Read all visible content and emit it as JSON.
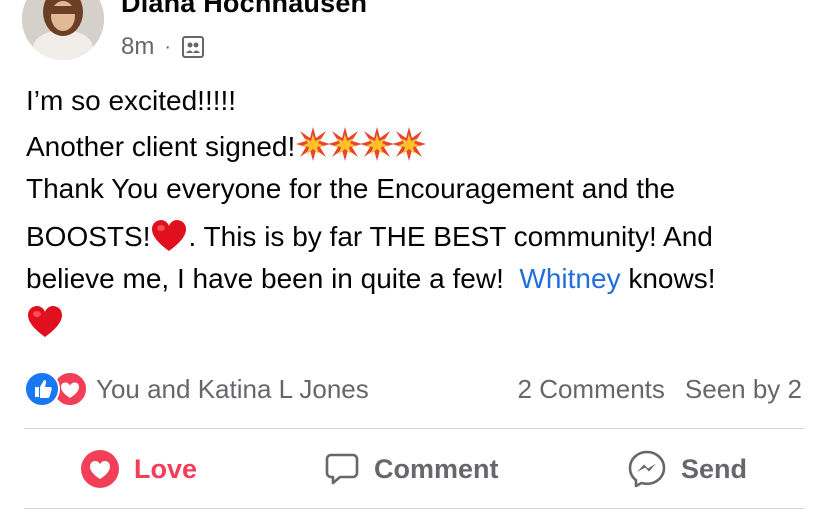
{
  "post": {
    "author": "Diana Hochhausen",
    "time": "8m",
    "separator": "·",
    "audience_icon": "group-icon",
    "more_icon": "more-horizontal-icon"
  },
  "content": {
    "line1": "I’m so excited!!!!!",
    "line2": "Another client signed!",
    "line3": "Thank You everyone for the Encouragement and the",
    "line4a": "BOOSTS!",
    "line4b": ". This is by far THE BEST community!  And",
    "line5a": "believe me, I have been in quite a few!  ",
    "mention": "Whitney",
    "line5b": " knows!",
    "emojis": [
      "collision-emoji",
      "collision-emoji",
      "collision-emoji",
      "collision-emoji",
      "red-heart-emoji",
      "red-heart-emoji"
    ]
  },
  "reactions": {
    "names": "You and Katina L Jones",
    "comments": "2 Comments",
    "seen": "Seen by 2",
    "icons": [
      "like-reaction-icon",
      "love-reaction-icon"
    ]
  },
  "actions": {
    "love": "Love",
    "comment": "Comment",
    "send": "Send"
  },
  "colors": {
    "love": "#f33e58",
    "like": "#1877f2",
    "mention": "#216fdb",
    "secondary_text": "#65676b",
    "divider": "#ced0d4"
  }
}
